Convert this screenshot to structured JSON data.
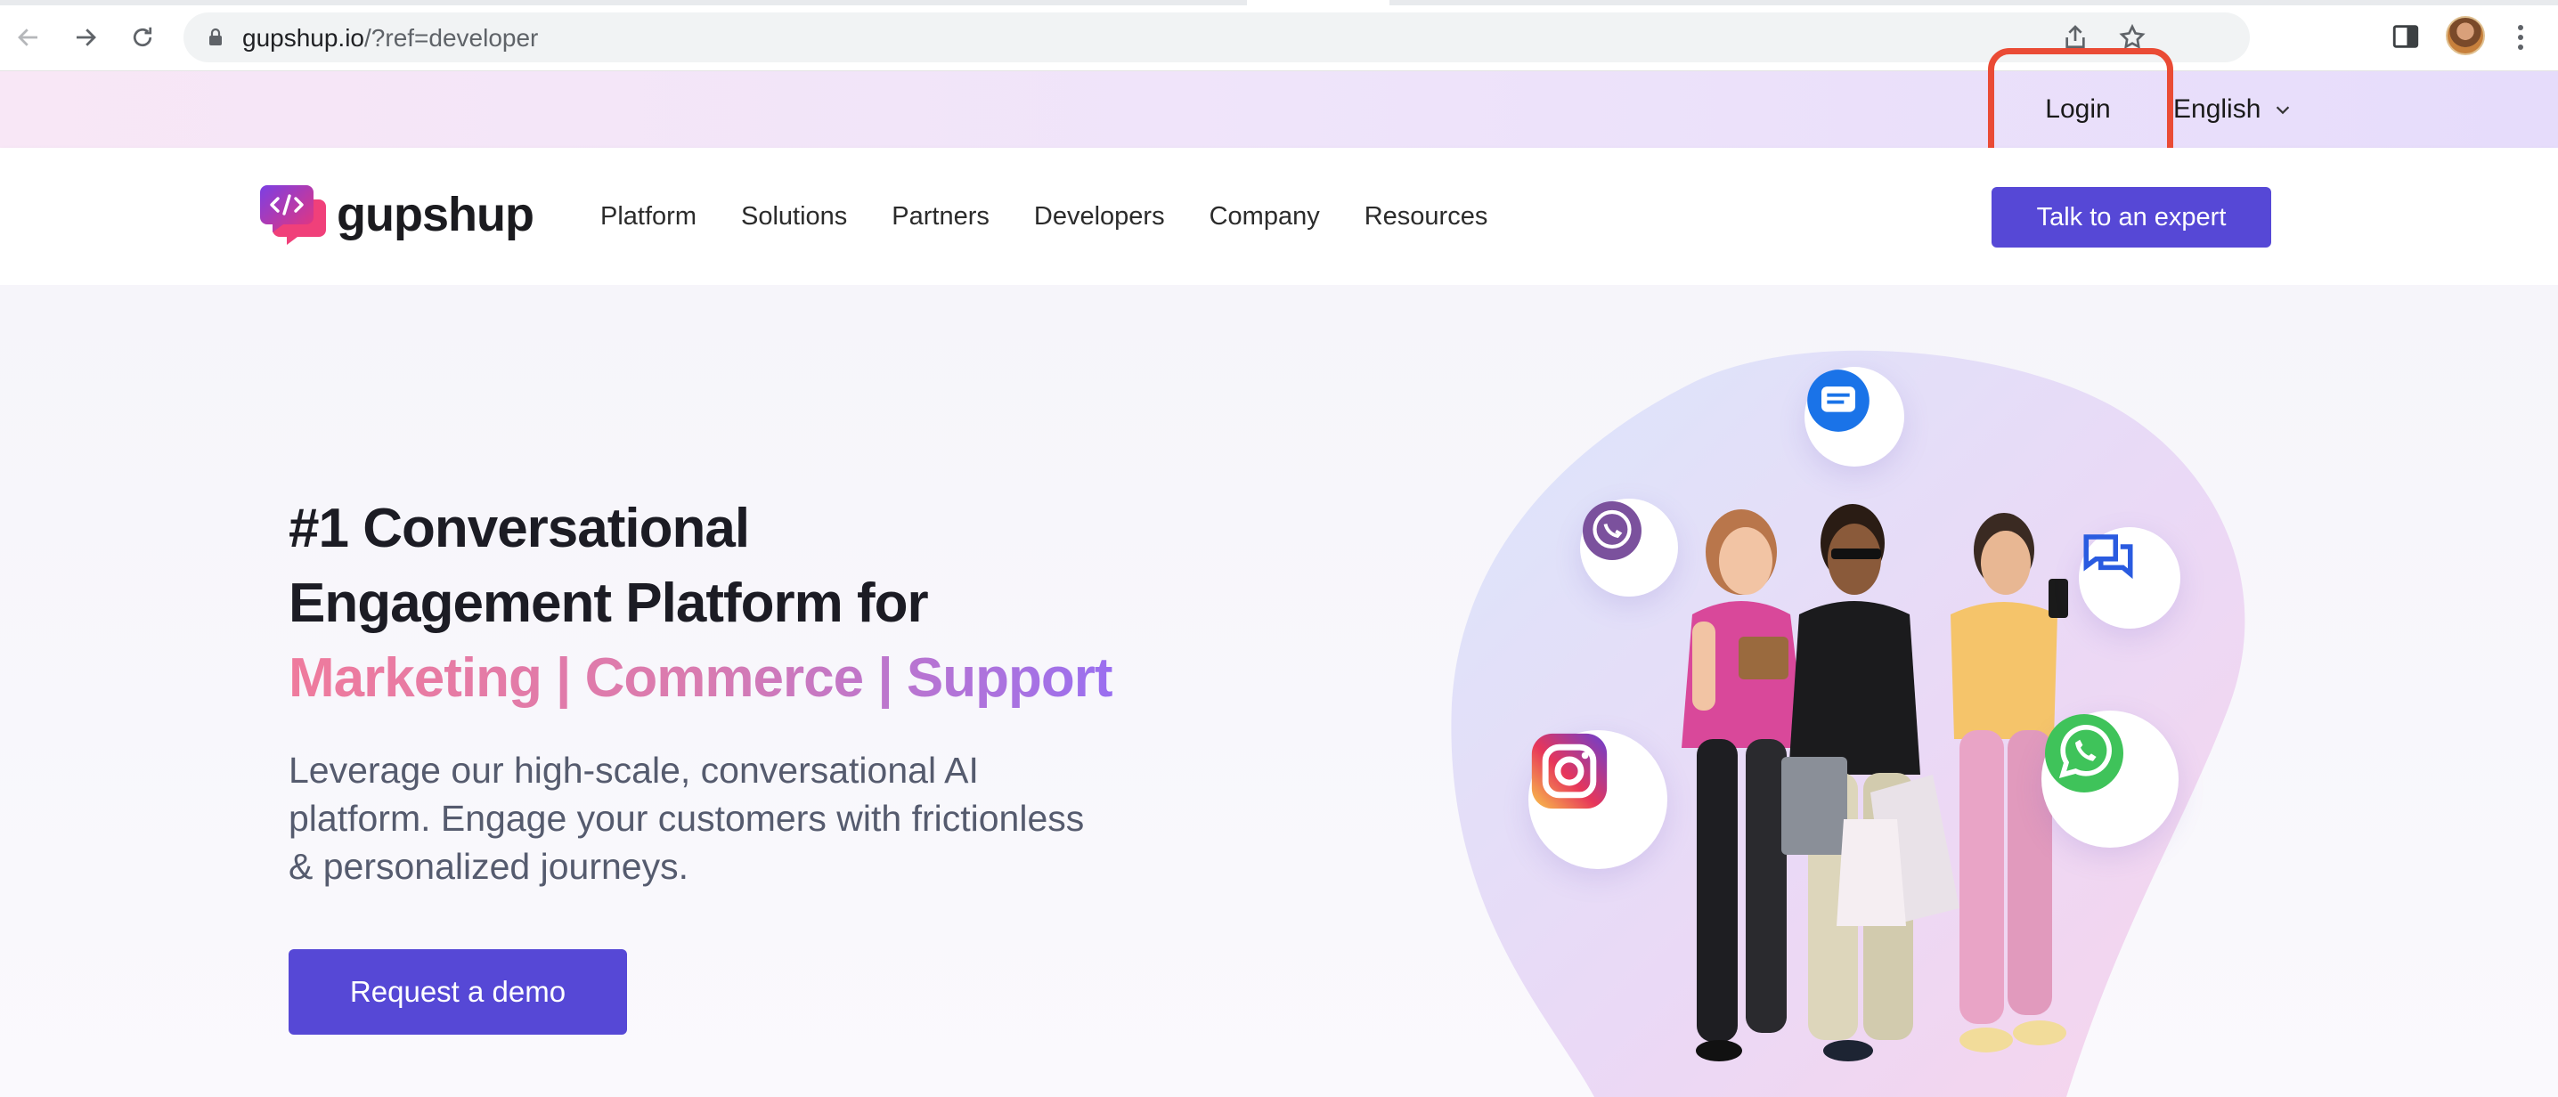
{
  "browser": {
    "url_host": "gupshup.io",
    "url_path": "/?ref=developer"
  },
  "topbar": {
    "login_label": "Login",
    "language_label": "English"
  },
  "nav": {
    "logo_text": "gupshup",
    "items": [
      {
        "label": "Platform"
      },
      {
        "label": "Solutions"
      },
      {
        "label": "Partners"
      },
      {
        "label": "Developers"
      },
      {
        "label": "Company"
      },
      {
        "label": "Resources"
      }
    ],
    "cta_label": "Talk to an expert"
  },
  "hero": {
    "title_line1": "#1 Conversational",
    "title_line2": "Engagement Platform for",
    "title_line3": "Marketing | Commerce | Support",
    "subtitle": "Leverage our high-scale, conversational AI platform. Engage your customers with frictionless & personalized journeys.",
    "cta_label": "Request a demo"
  },
  "channels": [
    "google-messages-icon",
    "viber-icon",
    "chat-bubbles-icon",
    "instagram-icon",
    "whatsapp-icon"
  ],
  "colors": {
    "brand_purple": "#5648d6",
    "highlight_red": "#ea4b35",
    "gradient_pink": "#ef7b9d",
    "gradient_violet": "#9a6ff0"
  }
}
